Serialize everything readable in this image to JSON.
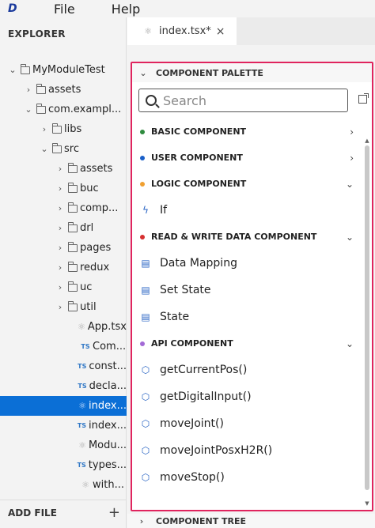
{
  "menubar": {
    "logo": "D",
    "items": [
      "File",
      "Help"
    ]
  },
  "explorer": {
    "title": "EXPLORER",
    "tree": [
      {
        "label": "MyModuleTest",
        "indent": 0,
        "chevron": "⌄",
        "icon": "folder"
      },
      {
        "label": "assets",
        "indent": 1,
        "chevron": "›",
        "icon": "folder"
      },
      {
        "label": "com.exampl...",
        "indent": 1,
        "chevron": "⌄",
        "icon": "folder"
      },
      {
        "label": "libs",
        "indent": 2,
        "chevron": "›",
        "icon": "folder"
      },
      {
        "label": "src",
        "indent": 2,
        "chevron": "⌄",
        "icon": "folder"
      },
      {
        "label": "assets",
        "indent": 3,
        "chevron": "›",
        "icon": "folder"
      },
      {
        "label": "buc",
        "indent": 3,
        "chevron": "›",
        "icon": "folder"
      },
      {
        "label": "comp...",
        "indent": 3,
        "chevron": "›",
        "icon": "folder"
      },
      {
        "label": "drl",
        "indent": 3,
        "chevron": "›",
        "icon": "folder"
      },
      {
        "label": "pages",
        "indent": 3,
        "chevron": "›",
        "icon": "folder"
      },
      {
        "label": "redux",
        "indent": 3,
        "chevron": "›",
        "icon": "folder"
      },
      {
        "label": "uc",
        "indent": 3,
        "chevron": "›",
        "icon": "folder"
      },
      {
        "label": "util",
        "indent": 3,
        "chevron": "›",
        "icon": "folder"
      },
      {
        "label": "App.tsx",
        "indent": 4,
        "chevron": "",
        "icon": "react"
      },
      {
        "label": "Com...",
        "indent": 4,
        "chevron": "",
        "icon": "ts"
      },
      {
        "label": "const...",
        "indent": 4,
        "chevron": "",
        "icon": "ts"
      },
      {
        "label": "decla...",
        "indent": 4,
        "chevron": "",
        "icon": "ts"
      },
      {
        "label": "index...",
        "indent": 4,
        "chevron": "",
        "icon": "react",
        "selected": true
      },
      {
        "label": "index...",
        "indent": 4,
        "chevron": "",
        "icon": "ts"
      },
      {
        "label": "Modu...",
        "indent": 4,
        "chevron": "",
        "icon": "react"
      },
      {
        "label": "types...",
        "indent": 4,
        "chevron": "",
        "icon": "ts"
      },
      {
        "label": "with...",
        "indent": 4,
        "chevron": "",
        "icon": "react"
      }
    ],
    "add_file_label": "ADD FILE",
    "add_file_symbol": "+"
  },
  "editor": {
    "tab_label": "index.tsx*",
    "tab_close": "×"
  },
  "palette": {
    "header": "COMPONENT PALETTE",
    "header_chevron": "⌄",
    "search_placeholder": "Search",
    "rows": [
      {
        "type": "cat",
        "label": "BASIC COMPONENT",
        "dot": "#2e8b3e",
        "arrow": "›"
      },
      {
        "type": "cat",
        "label": "USER COMPONENT",
        "dot": "#1a5fc8",
        "arrow": "›"
      },
      {
        "type": "cat",
        "label": "LOGIC COMPONENT",
        "dot": "#f0a030",
        "arrow": "⌄"
      },
      {
        "type": "item",
        "label": "If",
        "icon": "ϟ"
      },
      {
        "type": "cat",
        "label": "READ & WRITE DATA COMPONENT",
        "dot": "#d63030",
        "arrow": "⌄"
      },
      {
        "type": "item",
        "label": "Data Mapping",
        "icon": "▤"
      },
      {
        "type": "item",
        "label": "Set State",
        "icon": "▤"
      },
      {
        "type": "item",
        "label": "State",
        "icon": "▤"
      },
      {
        "type": "cat",
        "label": "API COMPONENT",
        "dot": "#a36ad6",
        "arrow": "⌄"
      },
      {
        "type": "item",
        "label": "getCurrentPos()",
        "icon": "⬡"
      },
      {
        "type": "item",
        "label": "getDigitalInput()",
        "icon": "⬡"
      },
      {
        "type": "item",
        "label": "moveJoint()",
        "icon": "⬡"
      },
      {
        "type": "item",
        "label": "moveJointPosxH2R()",
        "icon": "⬡"
      },
      {
        "type": "item",
        "label": "moveStop()",
        "icon": "⬡"
      }
    ]
  },
  "component_tree": {
    "header": "COMPONENT TREE",
    "chevron": "›"
  }
}
